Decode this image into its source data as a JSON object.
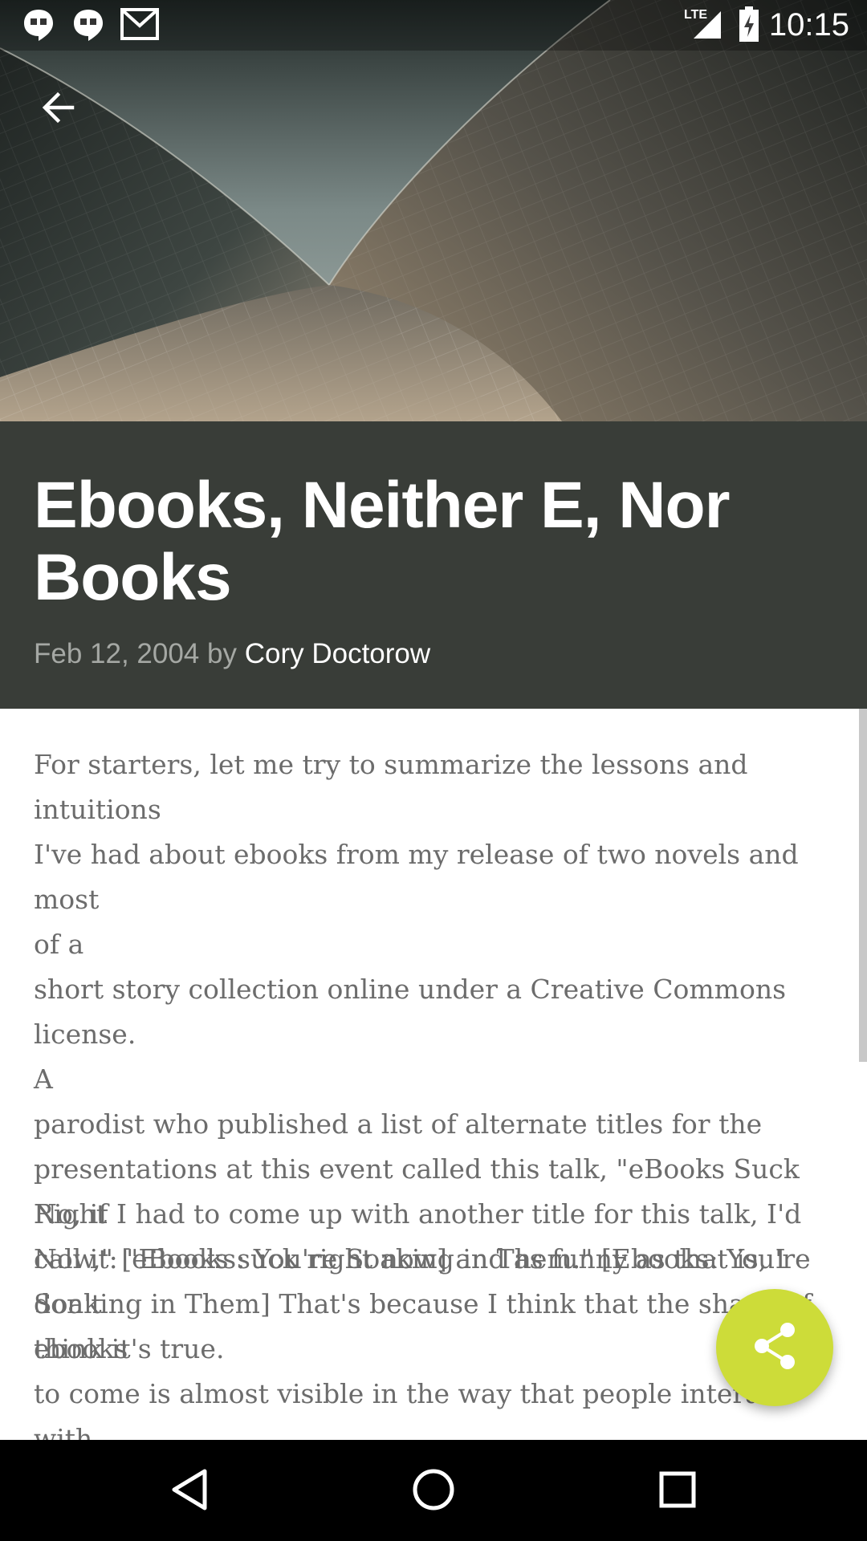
{
  "status_bar": {
    "time": "10:15",
    "network": "LTE",
    "icons": [
      "hangouts-icon",
      "hangouts-icon",
      "gmail-icon",
      "signal-icon",
      "battery-charging-icon"
    ]
  },
  "toolbar": {
    "back_icon": "arrow-back-icon"
  },
  "post": {
    "title": "Ebooks, Neither E, Nor Books",
    "date": "Feb 12, 2004",
    "by": "by",
    "author": "Cory Doctorow"
  },
  "article": {
    "paragraphs": [
      "For starters, let me try to summarize the lessons and intuitions\nI've had about ebooks from my release of two novels and most\nof a\nshort story collection online under a Creative Commons license.\nA\nparodist who published a list of alternate titles for the\npresentations at this event called this talk, \"eBooks Suck Right\nNow,\" [eBooks suck right now] and as funny as that is, I don't\nthink it's true.",
      "No, if I had to come up with another title for this talk, I'd\ncall it: \"Ebooks: You're Soaking in Them.\" [Ebooks: You're\nSoaking in Them] That's because I think that the shape of\nebooks\nto come is almost visible in the way that people interact with\ntext today, and that the job of authors who want to become rich"
    ]
  },
  "fab": {
    "icon": "share-icon",
    "color": "#cddc39"
  },
  "nav_bar": {
    "icons": [
      "nav-back-icon",
      "nav-home-icon",
      "nav-recents-icon"
    ]
  },
  "colors": {
    "title_band": "#393d38",
    "body_text": "#6c6c6c",
    "meta_text": "#a5a8a4"
  }
}
